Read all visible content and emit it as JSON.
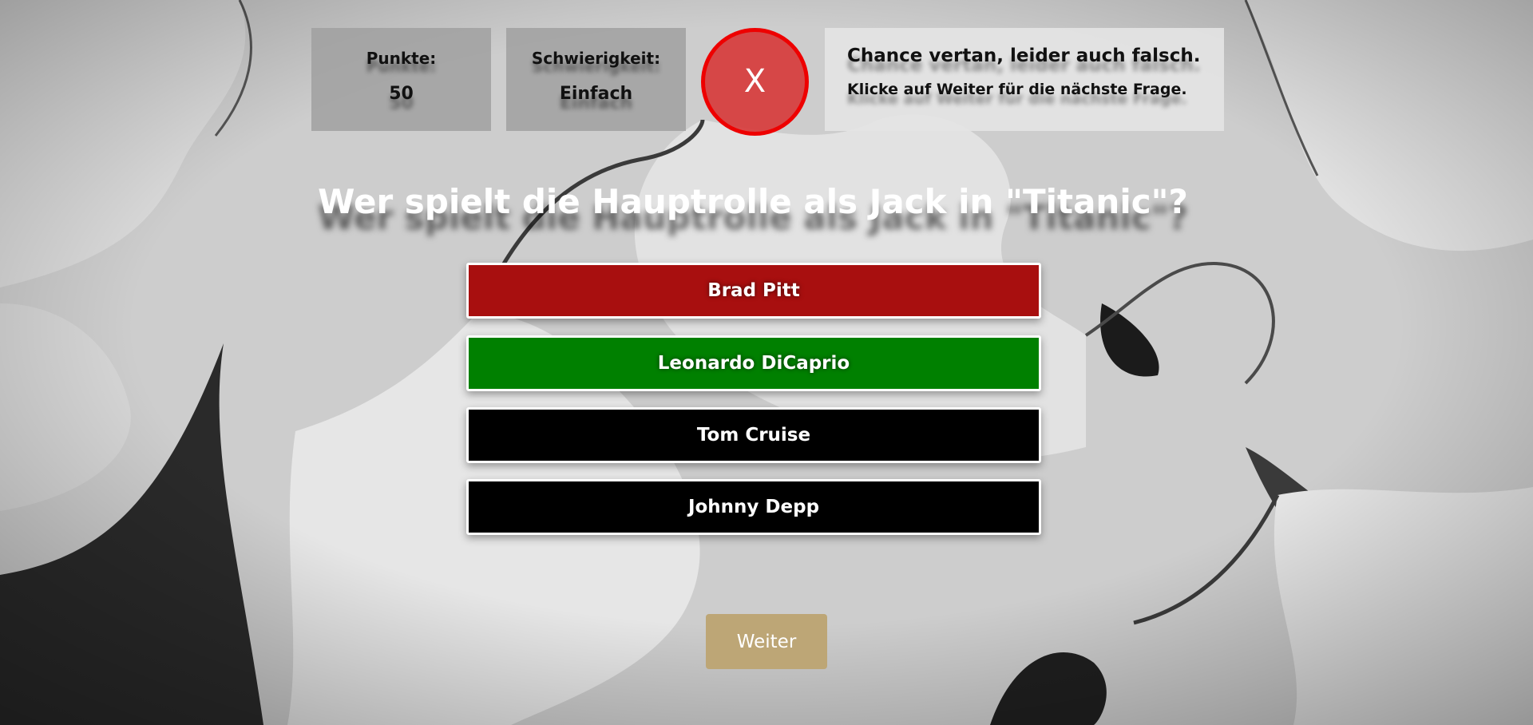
{
  "colors": {
    "wrong": "#a80f0f",
    "correct": "#008000",
    "neutral": "#000000",
    "result_circle": "#d73c3c",
    "result_border": "#ee0000",
    "next_button": "#bda676"
  },
  "stats": {
    "points_label": "Punkte:",
    "points_value": "50",
    "difficulty_label": "Schwierigkeit:",
    "difficulty_value": "Einfach"
  },
  "result": {
    "symbol": "X",
    "icon": "wrong-answer-icon",
    "message_line1": "Chance vertan, leider auch falsch.",
    "message_line2": "Klicke auf Weiter für die nächste Frage."
  },
  "question": "Wer spielt die Hauptrolle als Jack in \"Titanic\"?",
  "answers": [
    {
      "label": "Brad Pitt",
      "state": "wrong"
    },
    {
      "label": "Leonardo DiCaprio",
      "state": "correct"
    },
    {
      "label": "Tom Cruise",
      "state": "neutral"
    },
    {
      "label": "Johnny Depp",
      "state": "neutral"
    }
  ],
  "next_label": "Weiter"
}
